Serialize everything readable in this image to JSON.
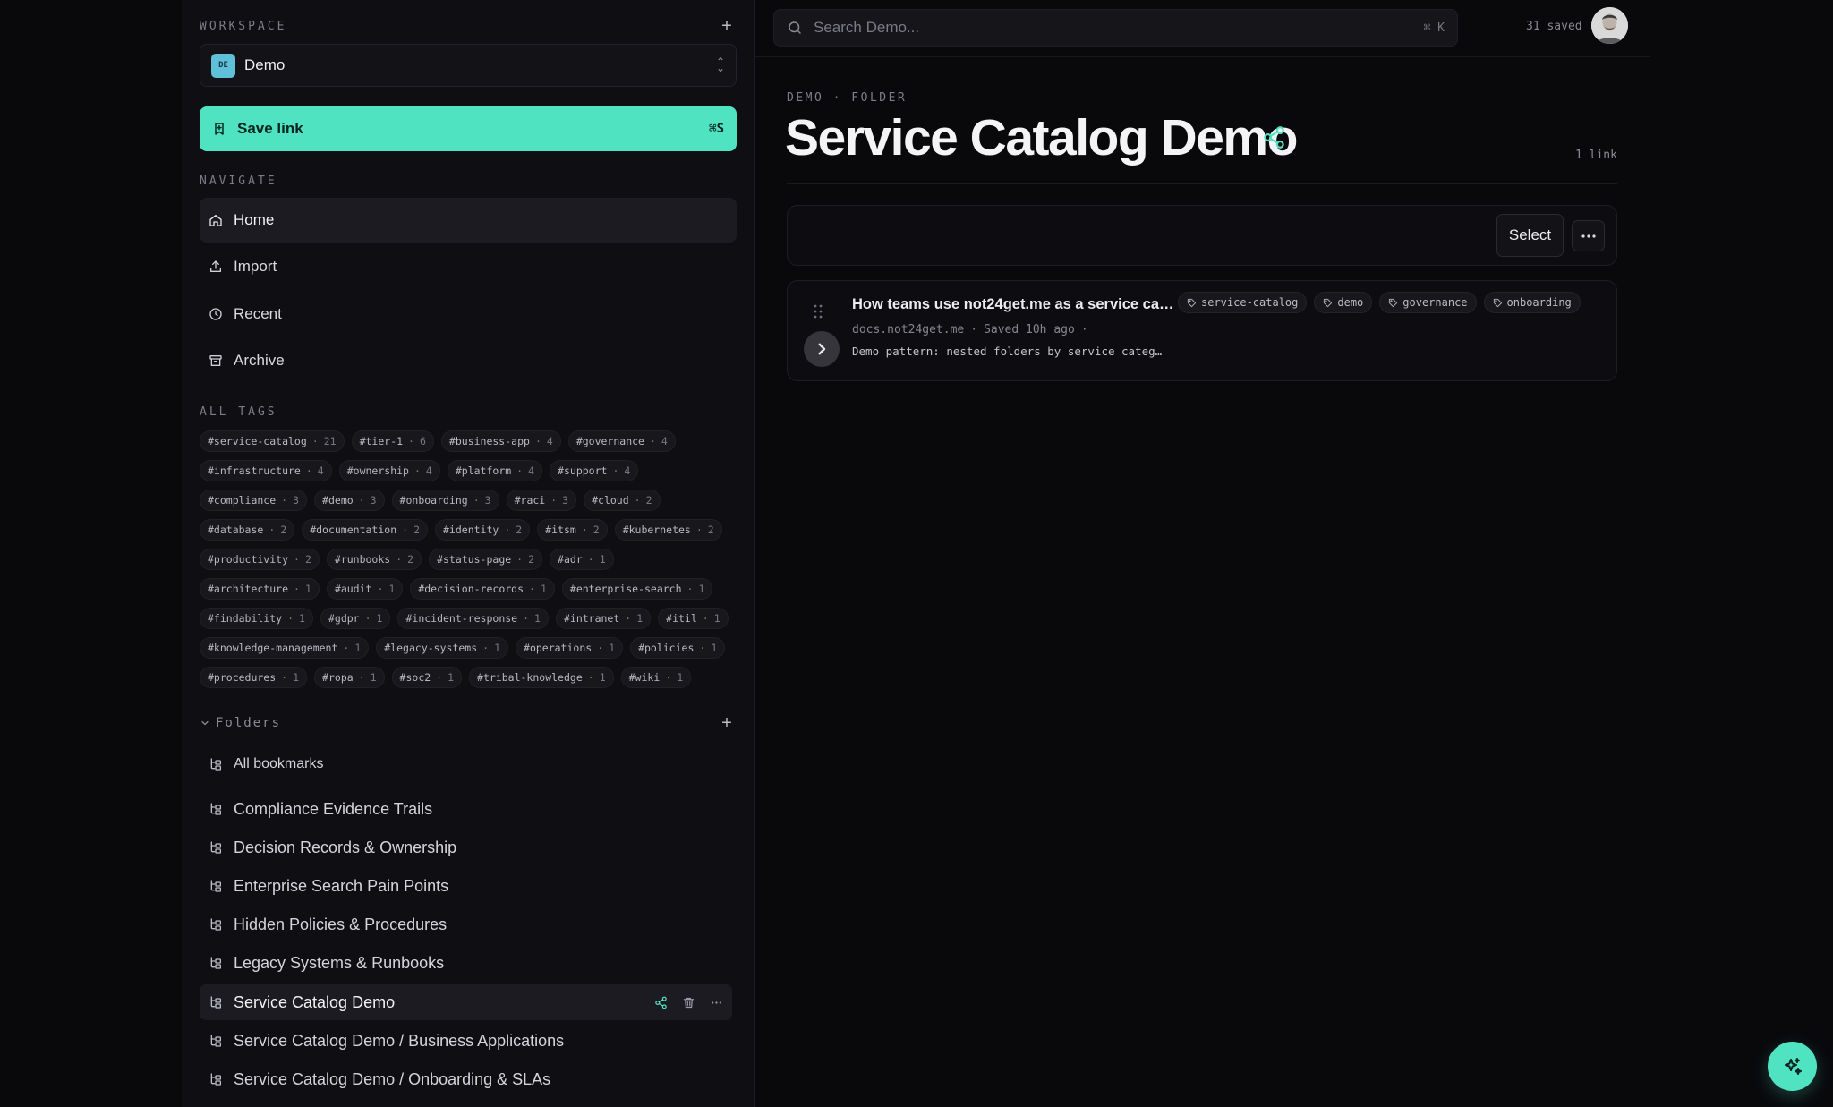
{
  "sidebar": {
    "workspace_label": "WORKSPACE",
    "workspace": {
      "badge": "DE",
      "name": "Demo"
    },
    "save_link": {
      "label": "Save link",
      "shortcut": "⌘S"
    },
    "navigate_label": "NAVIGATE",
    "nav": [
      {
        "label": "Home",
        "icon": "home-icon",
        "active": true
      },
      {
        "label": "Import",
        "icon": "upload-icon",
        "active": false
      },
      {
        "label": "Recent",
        "icon": "clock-icon",
        "active": false
      },
      {
        "label": "Archive",
        "icon": "archive-icon",
        "active": false
      }
    ],
    "tags_label": "ALL TAGS",
    "tags": [
      {
        "name": "#service-catalog",
        "count": "21"
      },
      {
        "name": "#tier-1",
        "count": "6"
      },
      {
        "name": "#business-app",
        "count": "4"
      },
      {
        "name": "#governance",
        "count": "4"
      },
      {
        "name": "#infrastructure",
        "count": "4"
      },
      {
        "name": "#ownership",
        "count": "4"
      },
      {
        "name": "#platform",
        "count": "4"
      },
      {
        "name": "#support",
        "count": "4"
      },
      {
        "name": "#compliance",
        "count": "3"
      },
      {
        "name": "#demo",
        "count": "3"
      },
      {
        "name": "#onboarding",
        "count": "3"
      },
      {
        "name": "#raci",
        "count": "3"
      },
      {
        "name": "#cloud",
        "count": "2"
      },
      {
        "name": "#database",
        "count": "2"
      },
      {
        "name": "#documentation",
        "count": "2"
      },
      {
        "name": "#identity",
        "count": "2"
      },
      {
        "name": "#itsm",
        "count": "2"
      },
      {
        "name": "#kubernetes",
        "count": "2"
      },
      {
        "name": "#productivity",
        "count": "2"
      },
      {
        "name": "#runbooks",
        "count": "2"
      },
      {
        "name": "#status-page",
        "count": "2"
      },
      {
        "name": "#adr",
        "count": "1"
      },
      {
        "name": "#architecture",
        "count": "1"
      },
      {
        "name": "#audit",
        "count": "1"
      },
      {
        "name": "#decision-records",
        "count": "1"
      },
      {
        "name": "#enterprise-search",
        "count": "1"
      },
      {
        "name": "#findability",
        "count": "1"
      },
      {
        "name": "#gdpr",
        "count": "1"
      },
      {
        "name": "#incident-response",
        "count": "1"
      },
      {
        "name": "#intranet",
        "count": "1"
      },
      {
        "name": "#itil",
        "count": "1"
      },
      {
        "name": "#knowledge-management",
        "count": "1"
      },
      {
        "name": "#legacy-systems",
        "count": "1"
      },
      {
        "name": "#operations",
        "count": "1"
      },
      {
        "name": "#policies",
        "count": "1"
      },
      {
        "name": "#procedures",
        "count": "1"
      },
      {
        "name": "#ropa",
        "count": "1"
      },
      {
        "name": "#soc2",
        "count": "1"
      },
      {
        "name": "#tribal-knowledge",
        "count": "1"
      },
      {
        "name": "#wiki",
        "count": "1"
      }
    ],
    "folders_label": "Folders",
    "folders": [
      {
        "label": "All bookmarks",
        "active": false,
        "small": true
      },
      {
        "label": "Compliance Evidence Trails",
        "active": false
      },
      {
        "label": "Decision Records & Ownership",
        "active": false
      },
      {
        "label": "Enterprise Search Pain Points",
        "active": false
      },
      {
        "label": "Hidden Policies & Procedures",
        "active": false
      },
      {
        "label": "Legacy Systems & Runbooks",
        "active": false
      },
      {
        "label": "Service Catalog Demo",
        "active": true
      },
      {
        "label": "Service Catalog Demo / Business Applications",
        "active": false
      },
      {
        "label": "Service Catalog Demo / Onboarding & SLAs",
        "active": false
      }
    ]
  },
  "header": {
    "search_placeholder": "Search Demo...",
    "search_shortcut": "⌘ K",
    "saved_count": "31 saved"
  },
  "main": {
    "breadcrumb": "DEMO · FOLDER",
    "title": "Service Catalog Demo",
    "link_count": "1 link",
    "select_label": "Select",
    "bookmarks": [
      {
        "title": "How teams use not24get.me as a service ca…",
        "tags": [
          "service-catalog",
          "demo",
          "governance",
          "onboarding"
        ],
        "domain": "docs.not24get.me",
        "saved": "Saved 10h ago",
        "description": "Demo pattern: nested folders by service categ…"
      }
    ]
  },
  "colors": {
    "accent": "#4fe3c1",
    "background": "#09090c",
    "sidebar": "#0f0f13",
    "workspace_badge": "#5fc0d7"
  }
}
